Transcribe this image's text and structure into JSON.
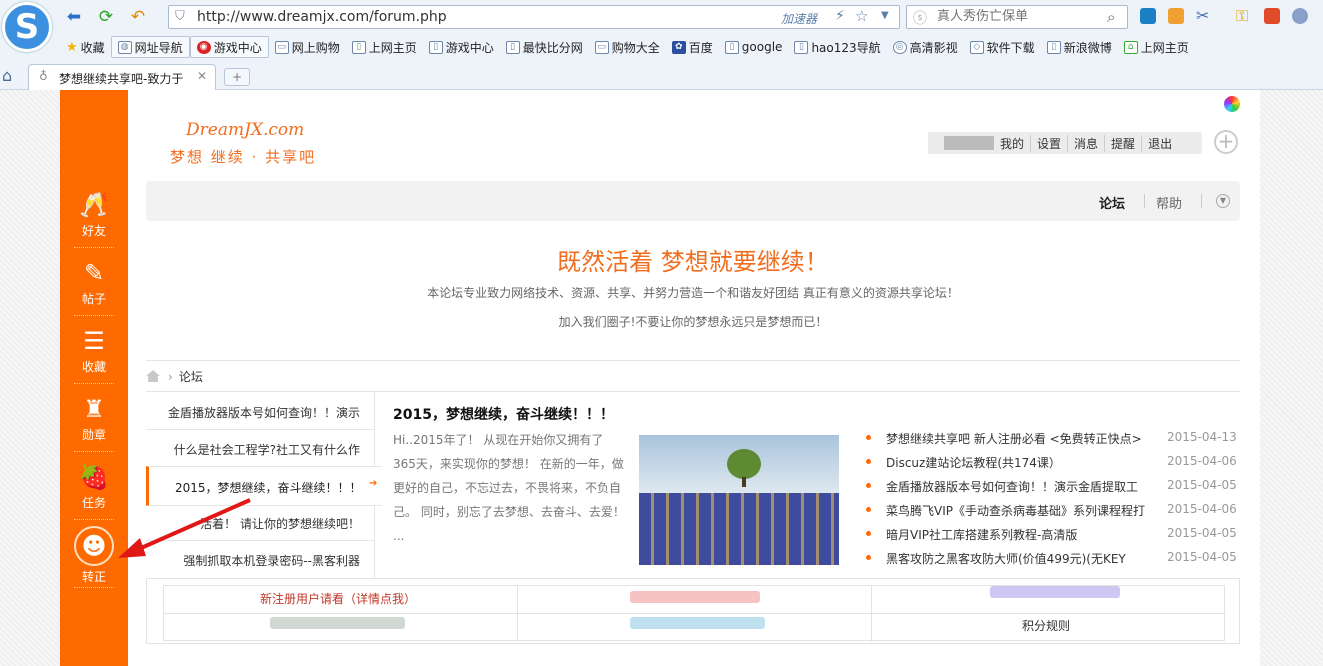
{
  "browser": {
    "url": "http://www.dreamjx.com/forum.php",
    "accelerator": "加速器",
    "search_placeholder": "真人秀伤亡保单",
    "logo_letter": "S",
    "tab_title": "梦想继续共享吧-致力于",
    "new_tab": "+",
    "bookmarks": [
      "收藏",
      "网址导航",
      "游戏中心",
      "网上购物",
      "上网主页",
      "游戏中心",
      "最快比分网",
      "购物大全",
      "百度",
      "google",
      "hao123导航",
      "高清影视",
      "软件下载",
      "新浪微博",
      "上网主页"
    ]
  },
  "sidebar": {
    "items": [
      {
        "label": "好友",
        "glyph": "🥂"
      },
      {
        "label": "帖子",
        "glyph": "✎"
      },
      {
        "label": "收藏",
        "glyph": "☰"
      },
      {
        "label": "勋章",
        "glyph": "♜"
      },
      {
        "label": "任务",
        "glyph": "🍓"
      },
      {
        "label": "转正",
        "glyph": "☻"
      }
    ]
  },
  "site": {
    "logo_en": "DreamJX.com",
    "logo_cn": "梦想 继续 · 共享吧",
    "top_nav": [
      "我的",
      "设置",
      "消息",
      "提醒",
      "退出"
    ],
    "nav_forum": "论坛",
    "nav_help": "帮助",
    "slogan": "既然活着 梦想就要继续！",
    "desc1": "本论坛专业致力网络技术、资源、共享、并努力营造一个和谐友好团结 真正有意义的资源共享论坛！",
    "desc2": "加入我们圈子!不要让你的梦想永远只是梦想而已！",
    "breadcrumb": "论坛"
  },
  "left_list": [
    "金盾播放器版本号如何查询！！演示",
    "什么是社会工程学?社工又有什么作",
    "2015，梦想继续，奋斗继续！！！",
    "活着！ 请让你的梦想继续吧！",
    "强制抓取本机登录密码--黑客利器"
  ],
  "post": {
    "title": "2015，梦想继续，奋斗继续！！！",
    "text": "Hi..2015年了！ 从现在开始你又拥有了365天，来实现你的梦想！ 在新的一年，做更好的自己，不忘过去，不畏将来，不负自己。 同时，别忘了去梦想、去奋斗、去爱！ ..."
  },
  "news": [
    {
      "title": "梦想继续共享吧 新人注册必看 <免费转正快点>",
      "date": "2015-04-13"
    },
    {
      "title": "Discuz建站论坛教程(共174课）",
      "date": "2015-04-06"
    },
    {
      "title": "金盾播放器版本号如何查询！！演示金盾提取工",
      "date": "2015-04-05"
    },
    {
      "title": "菜鸟腾飞VIP《手动查杀病毒基础》系列课程程打",
      "date": "2015-04-06"
    },
    {
      "title": "暗月VIP社工库搭建系列教程-高清版",
      "date": "2015-04-05"
    },
    {
      "title": "黑客攻防之黑客攻防大师(价值499元)(无KEY",
      "date": "2015-04-05"
    }
  ],
  "table": {
    "register": "新注册用户请看（详情点我）",
    "rules": "积分规则"
  },
  "colors": {
    "accent": "#ff6a00",
    "slogan": "#f26d1e"
  }
}
